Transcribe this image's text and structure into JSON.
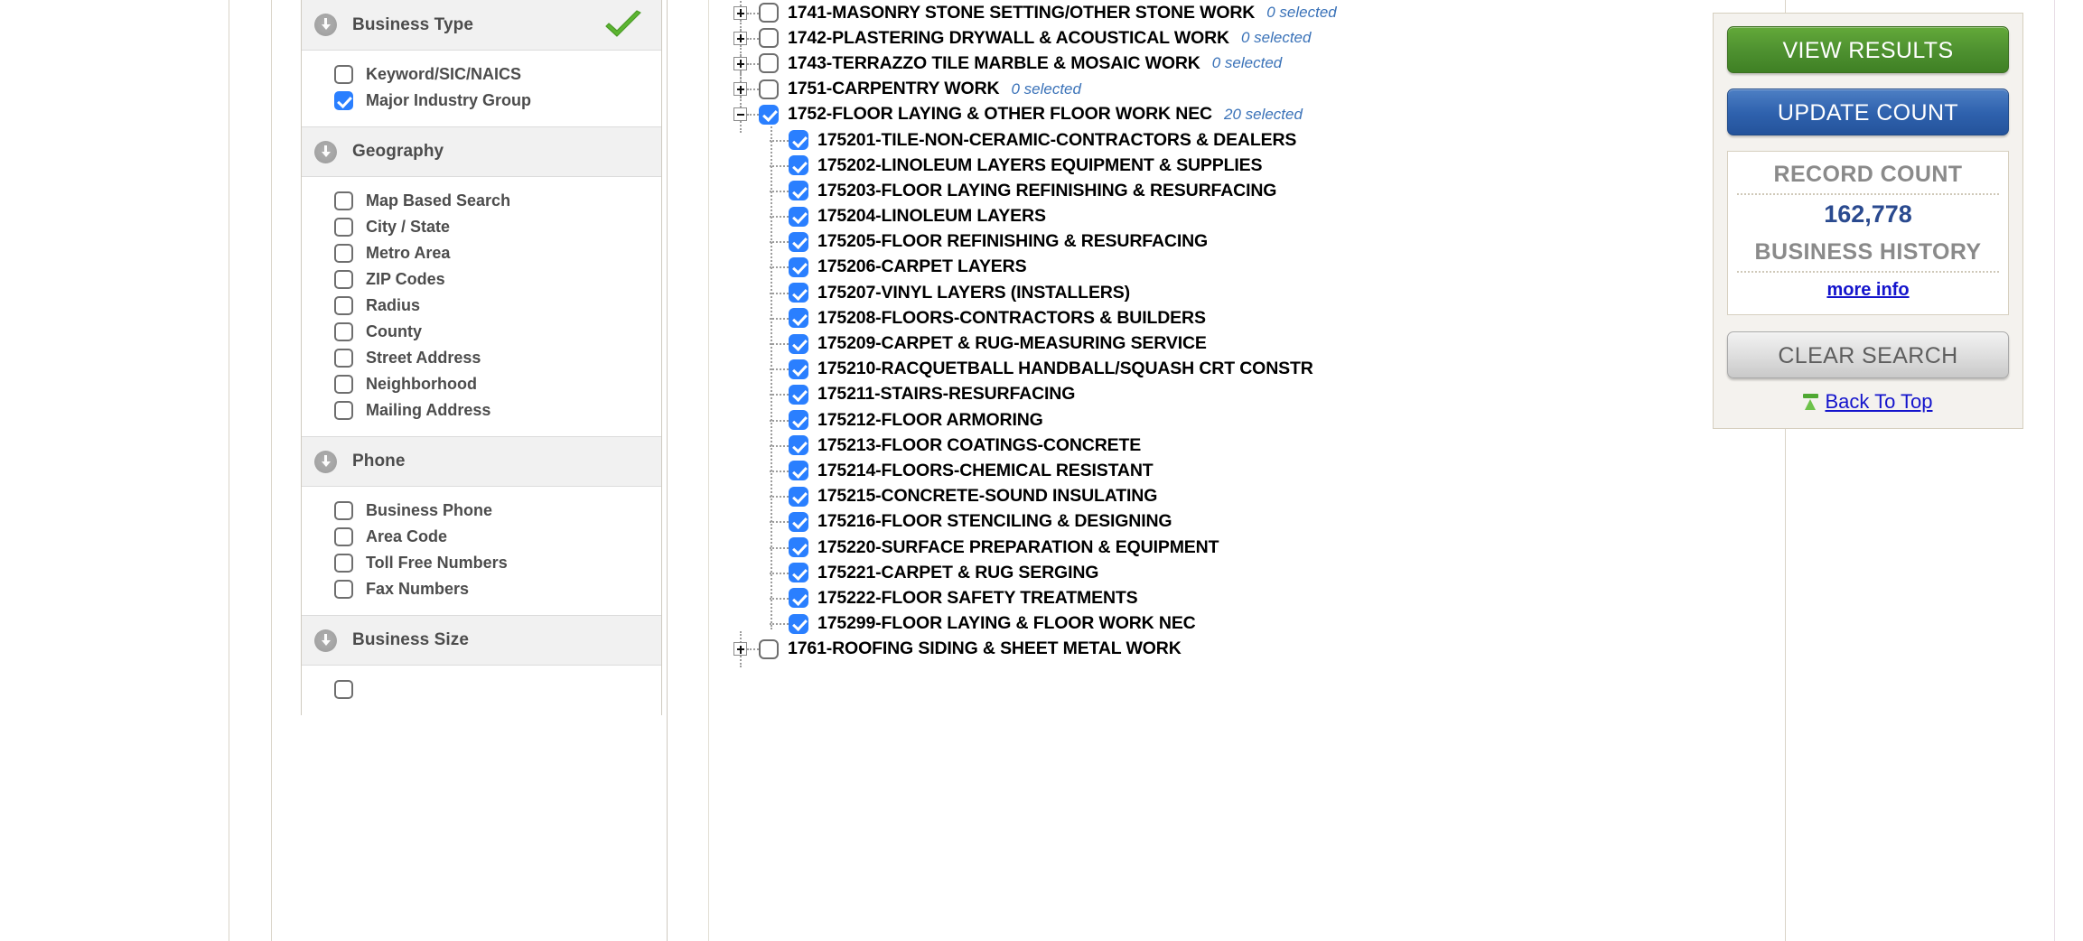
{
  "sidebar": {
    "sections": [
      {
        "title": "Business Type",
        "icon": "circle-down-arrow-icon",
        "has_check": true,
        "check_color": "#5cb531",
        "options": [
          {
            "label": "Keyword/SIC/NAICS",
            "checked": false
          },
          {
            "label": "Major Industry Group",
            "checked": true
          }
        ]
      },
      {
        "title": "Geography",
        "icon": "circle-down-arrow-icon",
        "has_check": false,
        "options": [
          {
            "label": "Map Based Search",
            "checked": false
          },
          {
            "label": "City / State",
            "checked": false
          },
          {
            "label": "Metro Area",
            "checked": false
          },
          {
            "label": "ZIP Codes",
            "checked": false
          },
          {
            "label": "Radius",
            "checked": false
          },
          {
            "label": "County",
            "checked": false
          },
          {
            "label": "Street Address",
            "checked": false
          },
          {
            "label": "Neighborhood",
            "checked": false
          },
          {
            "label": "Mailing Address",
            "checked": false
          }
        ]
      },
      {
        "title": "Phone",
        "icon": "circle-down-arrow-icon",
        "has_check": false,
        "options": [
          {
            "label": "Business Phone",
            "checked": false
          },
          {
            "label": "Area Code",
            "checked": false
          },
          {
            "label": "Toll Free Numbers",
            "checked": false
          },
          {
            "label": "Fax Numbers",
            "checked": false
          }
        ]
      },
      {
        "title": "Business Size",
        "icon": "circle-down-arrow-icon",
        "has_check": false,
        "options": [
          {
            "label": "",
            "checked": false
          }
        ]
      }
    ]
  },
  "tree": {
    "nodes": [
      {
        "label": "1741-MASONRY STONE SETTING/OTHER STONE WORK",
        "count": "0 selected",
        "checked": false,
        "expanded": false,
        "toggle": "plus"
      },
      {
        "label": "1742-PLASTERING DRYWALL & ACOUSTICAL WORK",
        "count": "0 selected",
        "checked": false,
        "expanded": false,
        "toggle": "plus"
      },
      {
        "label": "1743-TERRAZZO TILE MARBLE & MOSAIC WORK",
        "count": "0 selected",
        "checked": false,
        "expanded": false,
        "toggle": "plus"
      },
      {
        "label": "1751-CARPENTRY WORK",
        "count": "0 selected",
        "checked": false,
        "expanded": false,
        "toggle": "plus"
      },
      {
        "label": "1752-FLOOR LAYING & OTHER FLOOR WORK NEC",
        "count": "20 selected",
        "checked": true,
        "expanded": true,
        "toggle": "minus"
      }
    ],
    "children": [
      {
        "label": "175201-TILE-NON-CERAMIC-CONTRACTORS & DEALERS",
        "checked": true
      },
      {
        "label": "175202-LINOLEUM LAYERS EQUIPMENT & SUPPLIES",
        "checked": true
      },
      {
        "label": "175203-FLOOR LAYING REFINISHING & RESURFACING",
        "checked": true
      },
      {
        "label": "175204-LINOLEUM LAYERS",
        "checked": true
      },
      {
        "label": "175205-FLOOR REFINISHING & RESURFACING",
        "checked": true
      },
      {
        "label": "175206-CARPET LAYERS",
        "checked": true
      },
      {
        "label": "175207-VINYL LAYERS (INSTALLERS)",
        "checked": true
      },
      {
        "label": "175208-FLOORS-CONTRACTORS & BUILDERS",
        "checked": true
      },
      {
        "label": "175209-CARPET & RUG-MEASURING SERVICE",
        "checked": true
      },
      {
        "label": "175210-RACQUETBALL HANDBALL/SQUASH CRT CONSTR",
        "checked": true
      },
      {
        "label": "175211-STAIRS-RESURFACING",
        "checked": true
      },
      {
        "label": "175212-FLOOR ARMORING",
        "checked": true
      },
      {
        "label": "175213-FLOOR COATINGS-CONCRETE",
        "checked": true
      },
      {
        "label": "175214-FLOORS-CHEMICAL RESISTANT",
        "checked": true
      },
      {
        "label": "175215-CONCRETE-SOUND INSULATING",
        "checked": true
      },
      {
        "label": "175216-FLOOR STENCILING & DESIGNING",
        "checked": true
      },
      {
        "label": "175220-SURFACE PREPARATION & EQUIPMENT",
        "checked": true
      },
      {
        "label": "175221-CARPET & RUG SERGING",
        "checked": true
      },
      {
        "label": "175222-FLOOR SAFETY TREATMENTS",
        "checked": true
      },
      {
        "label": "175299-FLOOR LAYING & FLOOR WORK NEC",
        "checked": true
      }
    ],
    "trailing": [
      {
        "label": "1761-ROOFING SIDING & SHEET METAL WORK",
        "count": "",
        "checked": false,
        "expanded": false,
        "toggle": "plus"
      }
    ]
  },
  "actions": {
    "view_results_label": "VIEW RESULTS",
    "update_count_label": "UPDATE COUNT",
    "record_count_label": "RECORD COUNT",
    "record_count_value": "162,778",
    "business_history_label": "BUSINESS HISTORY",
    "more_info_label": "more info",
    "clear_search_label": "CLEAR SEARCH",
    "back_to_top_label": "Back To Top",
    "colors": {
      "green": "#4e9130",
      "blue": "#2f62ae",
      "count_value": "#2a4a8f",
      "link": "#1414cc"
    }
  }
}
